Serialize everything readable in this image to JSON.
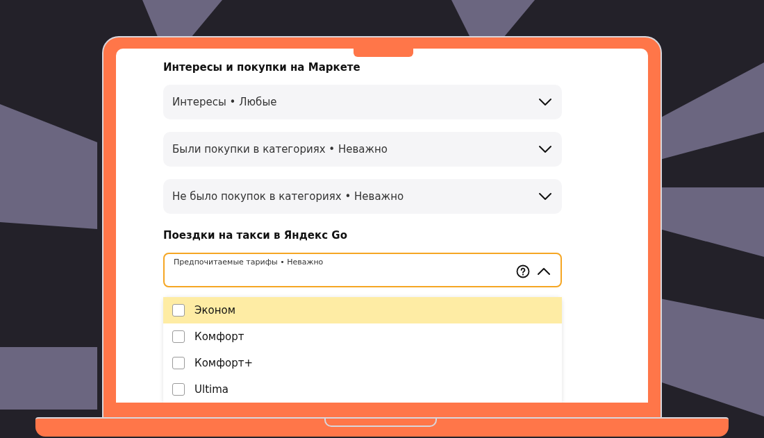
{
  "sections": [
    {
      "title": "Интересы и покупки на Маркете",
      "filters": [
        {
          "label": "Интересы • Любые",
          "expanded": false,
          "help": false
        },
        {
          "label": "Были покупки в категориях • Неважно",
          "expanded": false,
          "help": false
        },
        {
          "label": "Не было покупок в категориях • Неважно",
          "expanded": false,
          "help": false
        }
      ]
    },
    {
      "title": "Поездки на такси в Яндекс Go",
      "filters": [
        {
          "label": "Предпочитаемые тарифы • Неважно",
          "expanded": true,
          "help": true,
          "options": [
            {
              "label": "Эконом",
              "checked": false,
              "selected": true
            },
            {
              "label": "Комфорт",
              "checked": false,
              "selected": false
            },
            {
              "label": "Комфорт+",
              "checked": false,
              "selected": false
            },
            {
              "label": "Ultima",
              "checked": false,
              "selected": false
            }
          ]
        }
      ]
    }
  ]
}
